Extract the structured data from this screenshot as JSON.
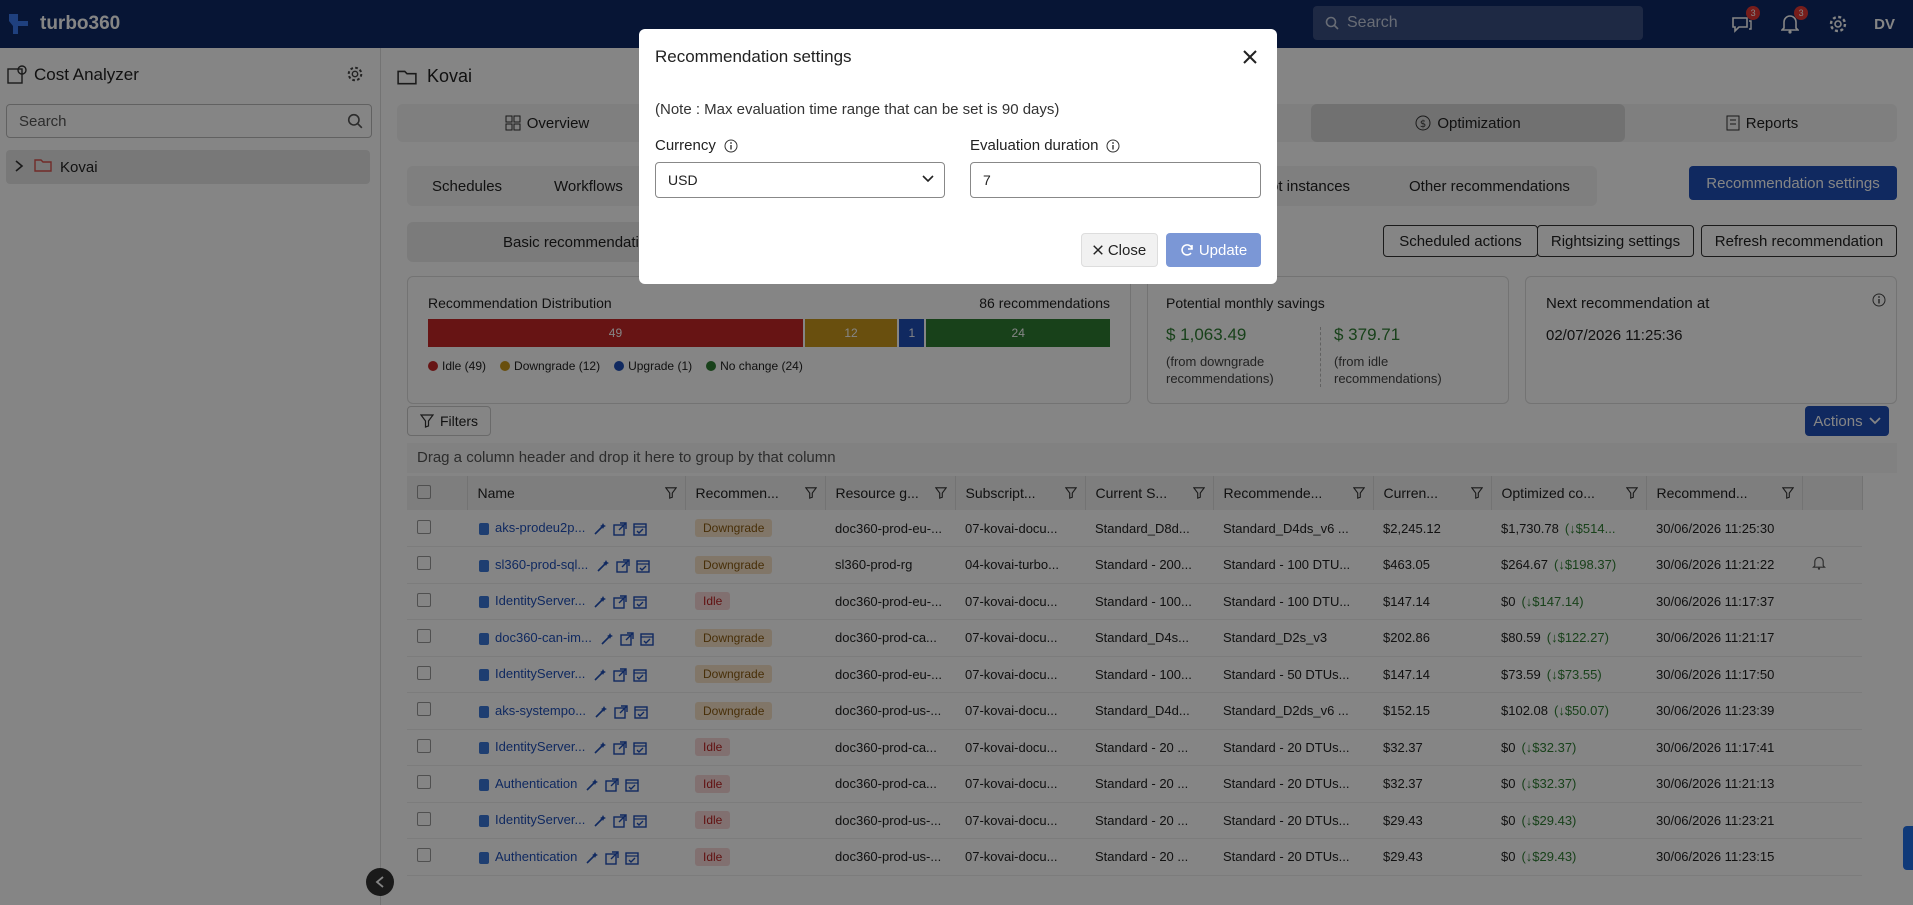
{
  "topbar": {
    "brand": "turbo360",
    "search_placeholder": "Search",
    "messages_badge": "3",
    "notifications_badge": "3",
    "user_initials": "DV"
  },
  "sidebar": {
    "title": "Cost Analyzer",
    "search_placeholder": "Search",
    "tree": [
      {
        "label": "Kovai"
      }
    ]
  },
  "main": {
    "title": "Kovai",
    "nav_tabs": [
      {
        "label": "Overview"
      },
      {
        "label": "Optimization"
      },
      {
        "label": "Reports"
      }
    ],
    "sub_tabs": [
      {
        "label": "Schedules"
      },
      {
        "label": "Workflows"
      },
      {
        "label": "ot instances"
      },
      {
        "label": "Other recommendations"
      }
    ],
    "recommendation_settings_label": "Recommendation settings",
    "basic_tab_label": "Basic recommendati",
    "scheduled_actions_label": "Scheduled actions",
    "rightsizing_settings_label": "Rightsizing settings",
    "refresh_recommendation_label": "Refresh recommendation",
    "distribution": {
      "title": "Recommendation Distribution",
      "count_label": "86 recommendations",
      "segments": [
        {
          "label": "49",
          "value": 49,
          "color": "#c62828"
        },
        {
          "label": "12",
          "value": 12,
          "color": "#c9971c"
        },
        {
          "label": "1",
          "value": 1,
          "color": "#1f4fb8"
        },
        {
          "label": "24",
          "value": 24,
          "color": "#2e7d32"
        }
      ],
      "legend": [
        {
          "label": "Idle (49)",
          "color": "#c62828"
        },
        {
          "label": "Downgrade (12)",
          "color": "#c9971c"
        },
        {
          "label": "Upgrade (1)",
          "color": "#1f4fb8"
        },
        {
          "label": "No change (24)",
          "color": "#2e7d32"
        }
      ]
    },
    "savings": {
      "title": "Potential monthly savings",
      "downgrade_value": "$ 1,063.49",
      "downgrade_note_1": "(from downgrade",
      "downgrade_note_2": "recommendations)",
      "idle_value": "$ 379.71",
      "idle_note_1": "(from idle",
      "idle_note_2": "recommendations)"
    },
    "next": {
      "title": "Next recommendation at",
      "value": "02/07/2026 11:25:36"
    },
    "filters_label": "Filters",
    "actions_label": "Actions",
    "group_hint": "Drag a column header and drop it here to group by that column",
    "columns": [
      "Name",
      "Recommen...",
      "Resource g...",
      "Subscript...",
      "Current S...",
      "Recommende...",
      "Curren...",
      "Optimized co...",
      "Recommend..."
    ],
    "rows": [
      {
        "name": "aks-prodeu2p...",
        "rec": "Downgrade",
        "rg": "doc360-prod-eu-...",
        "sub": "07-kovai-docu...",
        "cur_sku": "Standard_D8d...",
        "rec_sku": "Standard_D4ds_v6 ...",
        "cost": "$2,245.12",
        "opt": "$1,730.78",
        "delta": "(↓$514...",
        "date": "30/06/2026 11:25:30"
      },
      {
        "name": "sl360-prod-sql...",
        "rec": "Downgrade",
        "rg": "sl360-prod-rg",
        "sub": "04-kovai-turbo...",
        "cur_sku": "Standard - 200...",
        "rec_sku": "Standard - 100 DTU...",
        "cost": "$463.05",
        "opt": "$264.67",
        "delta": "(↓$198.37)",
        "date": "30/06/2026 11:21:22"
      },
      {
        "name": "IdentityServer...",
        "rec": "Idle",
        "rg": "doc360-prod-eu-...",
        "sub": "07-kovai-docu...",
        "cur_sku": "Standard - 100...",
        "rec_sku": "Standard - 100 DTU...",
        "cost": "$147.14",
        "opt": "$0",
        "delta": "(↓$147.14)",
        "date": "30/06/2026 11:17:37"
      },
      {
        "name": "doc360-can-im...",
        "rec": "Downgrade",
        "rg": "doc360-prod-ca...",
        "sub": "07-kovai-docu...",
        "cur_sku": "Standard_D4s...",
        "rec_sku": "Standard_D2s_v3",
        "cost": "$202.86",
        "opt": "$80.59",
        "delta": "(↓$122.27)",
        "date": "30/06/2026 11:21:17"
      },
      {
        "name": "IdentityServer...",
        "rec": "Downgrade",
        "rg": "doc360-prod-eu-...",
        "sub": "07-kovai-docu...",
        "cur_sku": "Standard - 100...",
        "rec_sku": "Standard - 50 DTUs...",
        "cost": "$147.14",
        "opt": "$73.59",
        "delta": "(↓$73.55)",
        "date": "30/06/2026 11:17:50"
      },
      {
        "name": "aks-systempo...",
        "rec": "Downgrade",
        "rg": "doc360-prod-us-...",
        "sub": "07-kovai-docu...",
        "cur_sku": "Standard_D4d...",
        "rec_sku": "Standard_D2ds_v6 ...",
        "cost": "$152.15",
        "opt": "$102.08",
        "delta": "(↓$50.07)",
        "date": "30/06/2026 11:23:39"
      },
      {
        "name": "IdentityServer...",
        "rec": "Idle",
        "rg": "doc360-prod-ca...",
        "sub": "07-kovai-docu...",
        "cur_sku": "Standard - 20 ...",
        "rec_sku": "Standard - 20 DTUs...",
        "cost": "$32.37",
        "opt": "$0",
        "delta": "(↓$32.37)",
        "date": "30/06/2026 11:17:41"
      },
      {
        "name": "Authentication",
        "rec": "Idle",
        "rg": "doc360-prod-ca...",
        "sub": "07-kovai-docu...",
        "cur_sku": "Standard - 20 ...",
        "rec_sku": "Standard - 20 DTUs...",
        "cost": "$32.37",
        "opt": "$0",
        "delta": "(↓$32.37)",
        "date": "30/06/2026 11:21:13"
      },
      {
        "name": "IdentityServer...",
        "rec": "Idle",
        "rg": "doc360-prod-us-...",
        "sub": "07-kovai-docu...",
        "cur_sku": "Standard - 20 ...",
        "rec_sku": "Standard - 20 DTUs...",
        "cost": "$29.43",
        "opt": "$0",
        "delta": "(↓$29.43)",
        "date": "30/06/2026 11:23:21"
      },
      {
        "name": "Authentication",
        "rec": "Idle",
        "rg": "doc360-prod-us-...",
        "sub": "07-kovai-docu...",
        "cur_sku": "Standard - 20 ...",
        "rec_sku": "Standard - 20 DTUs...",
        "cost": "$29.43",
        "opt": "$0",
        "delta": "(↓$29.43)",
        "date": "30/06/2026 11:23:15"
      }
    ]
  },
  "modal": {
    "title": "Recommendation settings",
    "note": "(Note : Max evaluation time range that can be set is 90 days)",
    "currency_label": "Currency",
    "currency_value": "USD",
    "duration_label": "Evaluation duration",
    "duration_value": "7",
    "close_label": "Close",
    "update_label": "Update"
  },
  "colors": {
    "topbar": "#0f2a66",
    "accent": "#1f4fb8",
    "savings_green": "#2e7d32"
  }
}
